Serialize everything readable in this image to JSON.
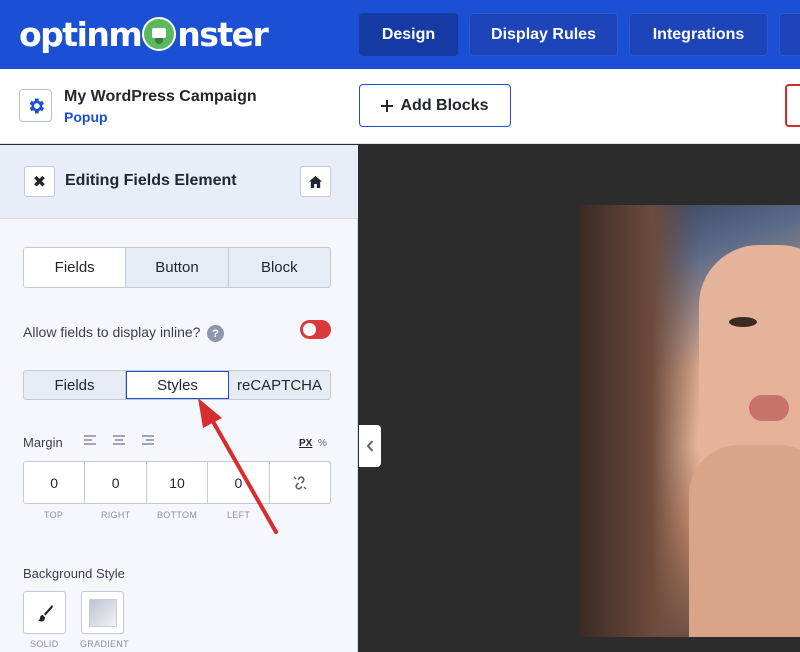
{
  "header": {
    "logo_text": "optinmonster",
    "tabs": [
      {
        "label": "Design",
        "active": true
      },
      {
        "label": "Display Rules",
        "active": false
      },
      {
        "label": "Integrations",
        "active": false
      }
    ]
  },
  "campaign": {
    "title": "My WordPress Campaign",
    "type": "Popup",
    "add_blocks_label": "Add Blocks"
  },
  "panel": {
    "title": "Editing Fields Element",
    "element_tabs": [
      "Fields",
      "Button",
      "Block"
    ],
    "active_element_tab": "Fields",
    "inline_label": "Allow fields to display inline?",
    "inline_toggle_on": false,
    "sub_tabs": [
      "Fields",
      "Styles",
      "reCAPTCHA"
    ],
    "active_sub_tab": "Styles",
    "margin": {
      "label": "Margin",
      "unit_px": "PX",
      "unit_percent": "%",
      "values": {
        "top": "0",
        "right": "0",
        "bottom": "10",
        "left": "0"
      },
      "captions": {
        "top": "TOP",
        "right": "RIGHT",
        "bottom": "BOTTOM",
        "left": "LEFT"
      }
    },
    "background": {
      "label": "Background Style",
      "options": [
        {
          "label": "SOLID",
          "icon": "paintbrush-icon"
        },
        {
          "label": "GRADIENT",
          "icon": "gradient-swatch"
        }
      ]
    }
  },
  "colors": {
    "brand_blue": "#1b4fd4",
    "toggle_red": "#d93b3b",
    "arrow_red": "#d62d2d"
  }
}
